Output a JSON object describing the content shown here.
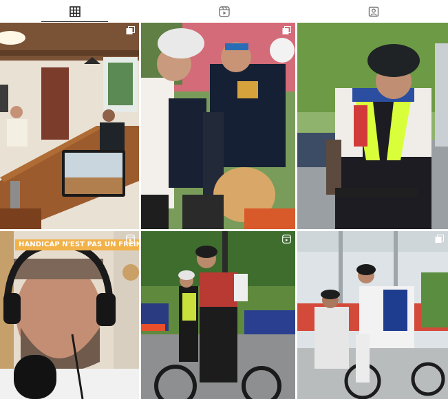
{
  "tabs": [
    {
      "icon": "grid-icon",
      "active": true
    },
    {
      "icon": "reels-icon",
      "active": false
    },
    {
      "icon": "tagged-icon",
      "active": false
    }
  ],
  "posts": [
    {
      "type": "carousel",
      "badge": "carousel-icon"
    },
    {
      "type": "carousel",
      "badge": "carousel-icon"
    },
    {
      "type": "image"
    },
    {
      "type": "reel",
      "badge": "reel-icon",
      "caption": "HANDICAP N'EST PAS UN FREIN"
    },
    {
      "type": "reel",
      "badge": "reel-icon"
    },
    {
      "type": "carousel",
      "badge": "carousel-icon"
    }
  ],
  "colors": {
    "tab_icon": "#262626",
    "caption_bg": "#f2b24a",
    "divider": "#ffffff"
  }
}
